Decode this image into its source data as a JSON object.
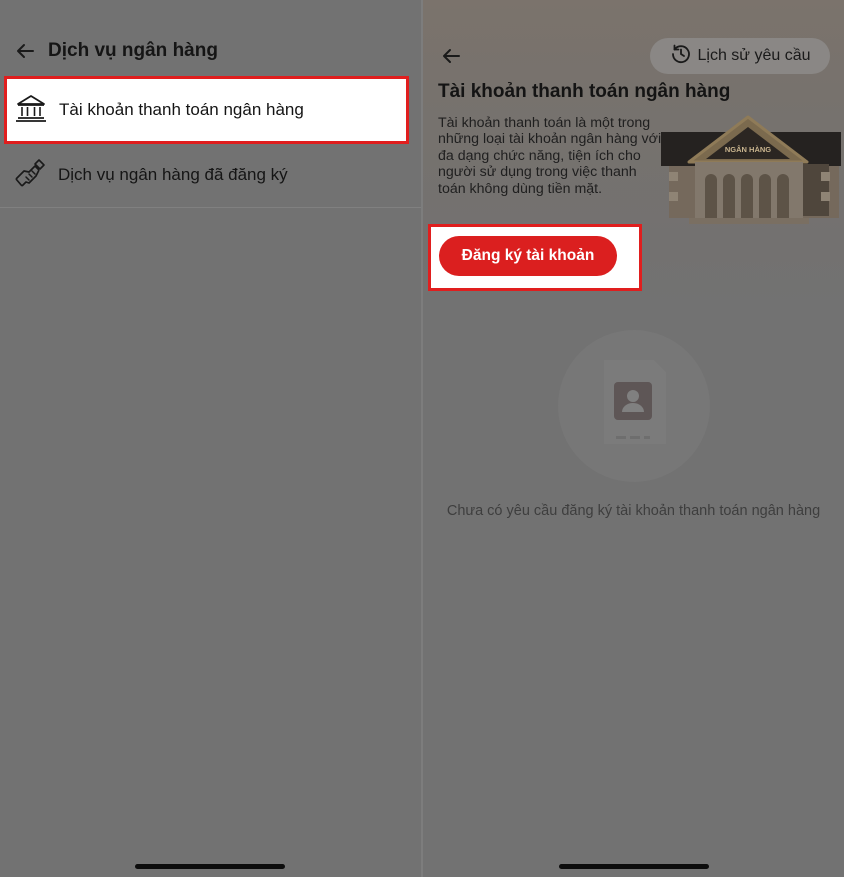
{
  "left": {
    "title": "Dịch vụ ngân hàng",
    "items": [
      {
        "label": "Tài khoản thanh toán ngân hàng",
        "icon": "bank-icon",
        "highlighted": true
      },
      {
        "label": "Dịch vụ ngân hàng đã đăng ký",
        "icon": "handshake-icon",
        "highlighted": false
      }
    ]
  },
  "right": {
    "history_label": "Lịch sử yêu cầu",
    "title": "Tài khoản thanh toán ngân hàng",
    "description": "Tài khoản thanh toán là một trong những loại tài khoản ngân hàng với đa dạng chức năng, tiện ích cho người sử dụng trong việc thanh toán không dùng tiền mặt.",
    "illustration_sign": "NGÂN HÀNG",
    "register_button": "Đăng ký tài khoản",
    "empty_message": "Chưa có yêu cầu đăng ký tài khoản thanh toán ngân hàng"
  },
  "colors": {
    "accent_red": "#db1f1f",
    "highlight_border": "#e01e1e",
    "overlay_gray": "#727272"
  }
}
